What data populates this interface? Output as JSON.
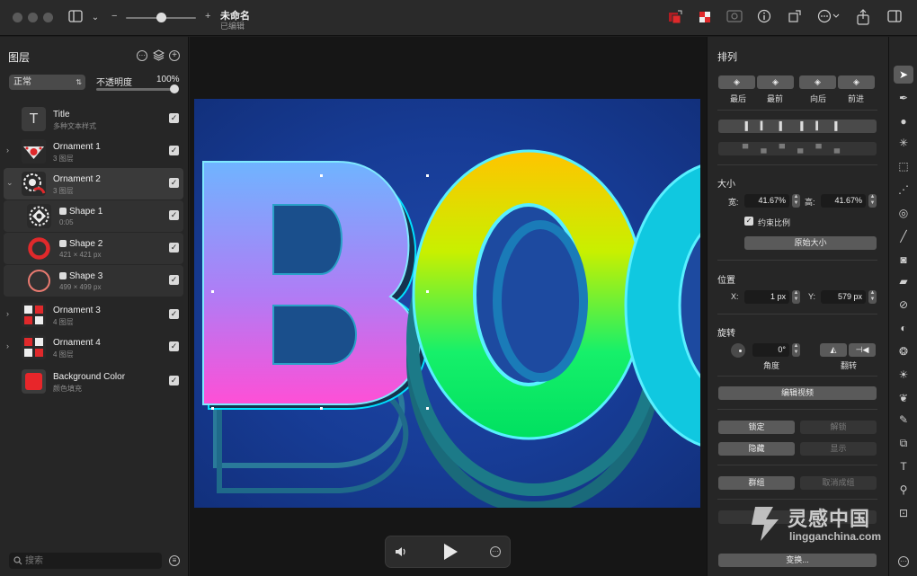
{
  "window": {
    "doc_title": "未命名",
    "doc_status": "已编辑"
  },
  "toolbar": {
    "zoom_minus": "−",
    "zoom_plus": "+",
    "icons": [
      "sidebar-icon",
      "chevron-down-icon",
      "color-swap-icon",
      "color-mode-icon",
      "image-icon",
      "info-icon",
      "resize-icon",
      "more-icon",
      "share-icon",
      "inspector-icon"
    ]
  },
  "layers_panel": {
    "title": "图层",
    "blend_mode": "正常",
    "opacity_label": "不透明度",
    "opacity_value": "100%",
    "opacity_fraction": 1.0,
    "layers": [
      {
        "name": "Title",
        "sub": "多种文本样式",
        "kind": "text",
        "visible": true,
        "expanded": null,
        "indent": 0
      },
      {
        "name": "Ornament 1",
        "sub": "3 图层",
        "kind": "group",
        "visible": true,
        "expanded": false,
        "indent": 0
      },
      {
        "name": "Ornament 2",
        "sub": "3 图层",
        "kind": "group",
        "visible": true,
        "expanded": true,
        "indent": 0
      },
      {
        "name": "Shape 1",
        "sub": "0:05",
        "kind": "shape",
        "visible": true,
        "expanded": null,
        "indent": 1
      },
      {
        "name": "Shape 2",
        "sub": "421 × 421 px",
        "kind": "shape",
        "visible": true,
        "expanded": null,
        "indent": 1
      },
      {
        "name": "Shape 3",
        "sub": "499 × 499 px",
        "kind": "shape",
        "visible": true,
        "expanded": null,
        "indent": 1
      },
      {
        "name": "Ornament 3",
        "sub": "4 图层",
        "kind": "group",
        "visible": true,
        "expanded": false,
        "indent": 0
      },
      {
        "name": "Ornament 4",
        "sub": "4 图层",
        "kind": "group",
        "visible": true,
        "expanded": false,
        "indent": 0
      },
      {
        "name": "Background Color",
        "sub": "颜色填充",
        "kind": "color",
        "visible": true,
        "expanded": null,
        "indent": 0
      }
    ],
    "search_placeholder": "搜索"
  },
  "canvas": {
    "artwork_text": "BOO",
    "background_color": "#173c96"
  },
  "inspector": {
    "arrange": {
      "title": "排列",
      "order_buttons": [
        "最后",
        "最前",
        "向后",
        "前进"
      ]
    },
    "size": {
      "title": "大小",
      "width_label": "宽:",
      "width_value": "41.67%",
      "height_label": "高:",
      "height_value": "41.67%",
      "constrain_label": "约束比例",
      "constrain_checked": true,
      "original_size_button": "原始大小"
    },
    "position": {
      "title": "位置",
      "x_label": "X:",
      "x_value": "1 px",
      "y_label": "Y:",
      "y_value": "579 px"
    },
    "rotation": {
      "title": "旋转",
      "angle_value": "0°",
      "angle_label": "角度",
      "flip_label": "翻转"
    },
    "buttons": {
      "edit_video": "编辑视频",
      "lock": "锁定",
      "unlock": "解锁",
      "hide": "隐藏",
      "show": "显示",
      "group": "群组",
      "ungroup": "取消成组",
      "transform": "变换..."
    }
  },
  "tools": [
    "pointer-icon",
    "pen-nib-icon",
    "shapes-icon",
    "sparkle-icon",
    "selection-rect-icon",
    "magic-wand-icon",
    "color-select-icon",
    "brush-icon",
    "fill-bucket-icon",
    "eraser-icon",
    "bandage-icon",
    "smudge-icon",
    "blur-icon",
    "sun-icon",
    "clone-icon",
    "pen-icon",
    "shape-combine-icon",
    "text-icon",
    "zoom-icon",
    "color-picker-icon"
  ],
  "watermark": {
    "cn": "灵感中国",
    "en": "lingganchina.com"
  },
  "colors": {
    "accent_red": "#e0292b",
    "background_color_swatch": "#e8262a"
  }
}
